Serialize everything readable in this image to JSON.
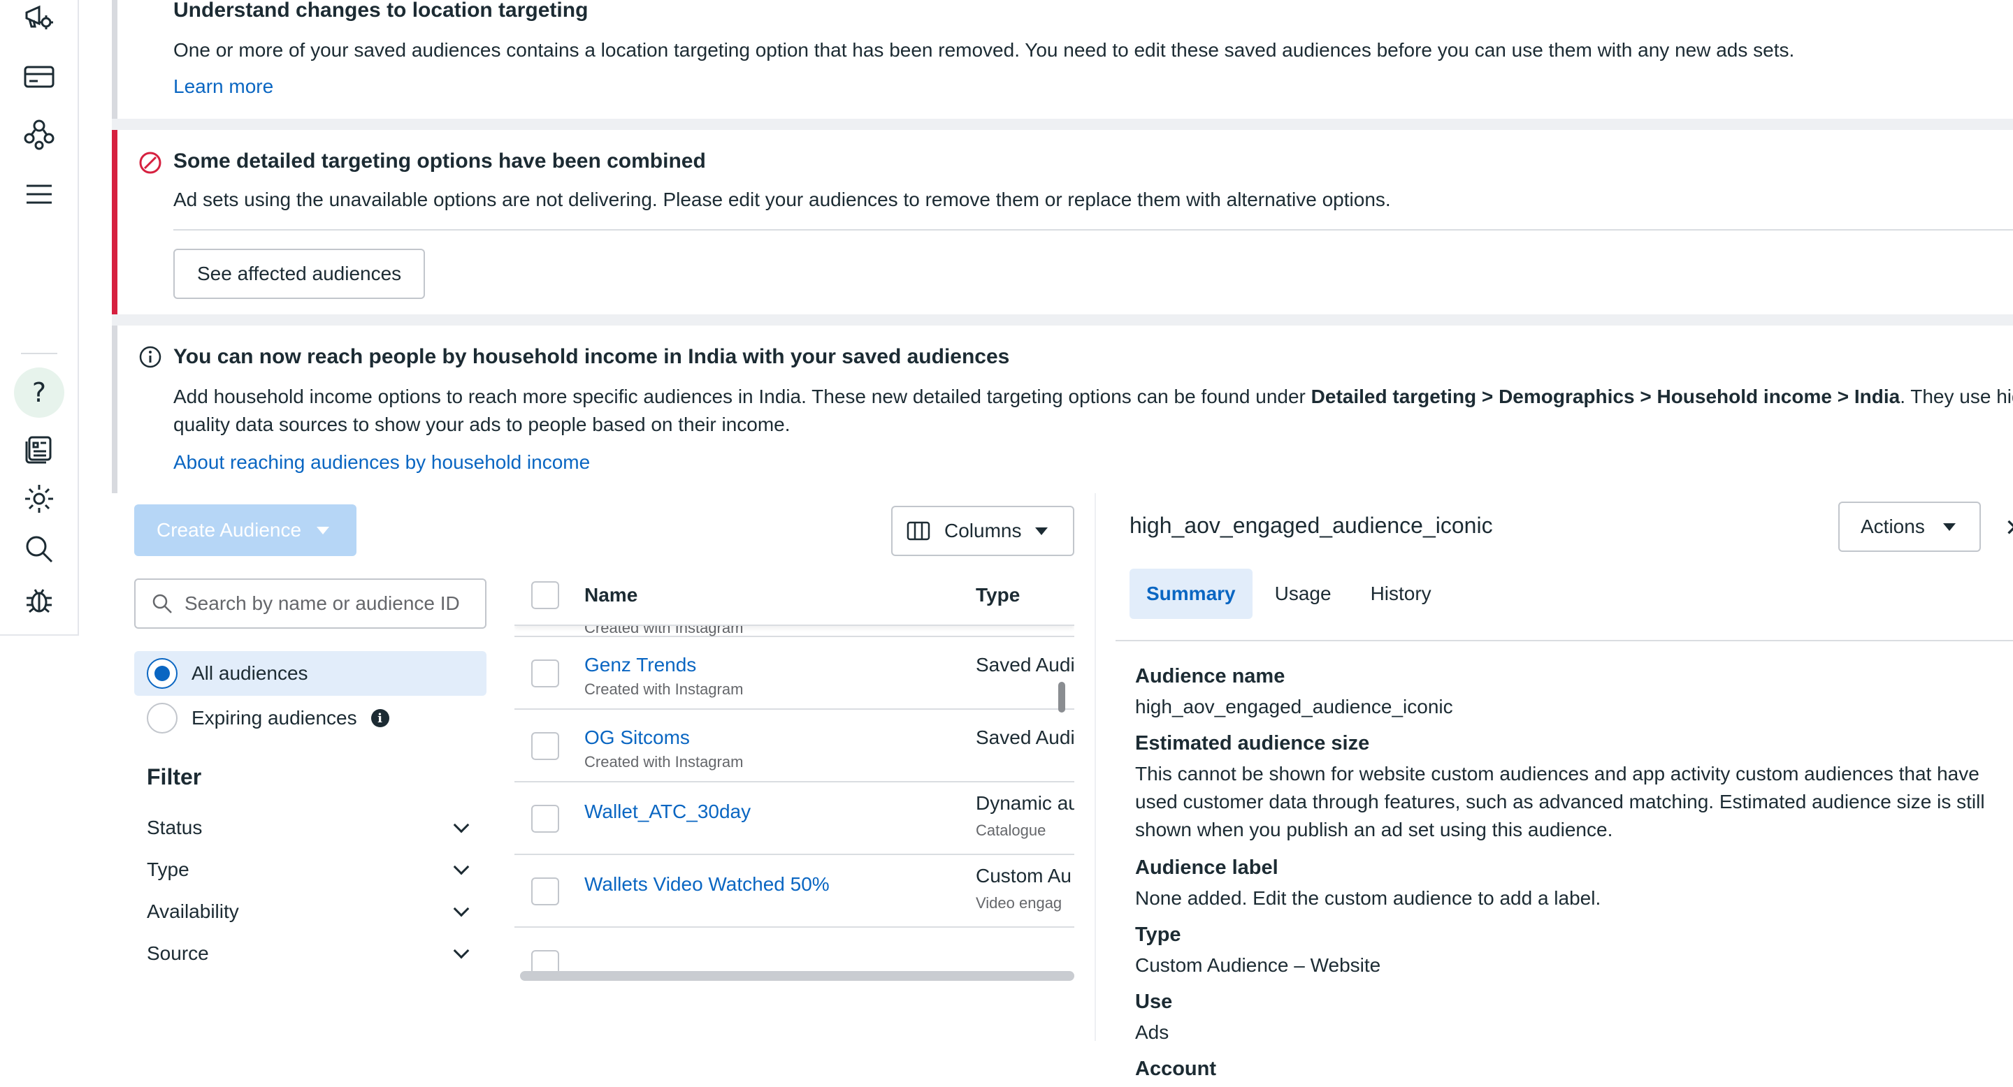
{
  "rail": {
    "icons": [
      "megaphone-gear-icon",
      "billing-card-icon",
      "audiences-icon",
      "menu-icon",
      "help-icon",
      "pages-icon",
      "settings-gear-icon",
      "search-icon",
      "bug-icon"
    ]
  },
  "notices": {
    "location": {
      "title": "Understand changes to location targeting",
      "body": "One or more of your saved audiences contains a location targeting option that has been removed. You need to edit these saved audiences before you can use them with any new ads sets.",
      "link": "Learn more"
    },
    "combined": {
      "title": "Some detailed targeting options have been combined",
      "body": "Ad sets using the unavailable options are not delivering. Please edit your audiences to remove them or replace them with alternative options.",
      "button": "See affected audiences"
    },
    "income": {
      "title": "You can now reach people by household income in India with your saved audiences",
      "body_prefix": "Add household income options to reach more specific audiences in India. These new detailed targeting options can be found under ",
      "body_bold": "Detailed targeting > Demographics > Household income > India",
      "body_suffix": ". They use hig",
      "body_line2": "quality data sources to show your ads to people based on their income.",
      "link": "About reaching audiences by household income"
    }
  },
  "list": {
    "create_label": "Create Audience",
    "columns_label": "Columns",
    "search_placeholder": "Search by name or audience ID",
    "radios": [
      {
        "label": "All audiences",
        "selected": true
      },
      {
        "label": "Expiring audiences",
        "selected": false
      }
    ],
    "filter_title": "Filter",
    "filters": [
      "Status",
      "Type",
      "Availability",
      "Source"
    ],
    "table": {
      "headers": {
        "name": "Name",
        "type": "Type"
      },
      "partial_top_sub": "Created with Instagram",
      "rows": [
        {
          "name": "Genz Trends",
          "sub": "Created with Instagram",
          "type": "Saved Audi",
          "type_sub": ""
        },
        {
          "name": "OG Sitcoms",
          "sub": "Created with Instagram",
          "type": "Saved Audi",
          "type_sub": ""
        },
        {
          "name": "Wallet_ATC_30day",
          "sub": "",
          "type": "Dynamic au",
          "type_sub": "Catalogue"
        },
        {
          "name": "Wallets Video Watched 50%",
          "sub": "",
          "type": "Custom Au",
          "type_sub": "Video engag"
        }
      ]
    }
  },
  "detail": {
    "title": "high_aov_engaged_audience_iconic",
    "actions_label": "Actions",
    "tabs": [
      "Summary",
      "Usage",
      "History"
    ],
    "fields": {
      "name_label": "Audience name",
      "name_value": "high_aov_engaged_audience_iconic",
      "size_label": "Estimated audience size",
      "size_value": "This cannot be shown for website custom audiences and app activity custom audiences that have used customer data through features, such as advanced matching. Estimated audience size is still shown when you publish an ad set using this audience.",
      "label_label": "Audience label",
      "label_value": "None added. Edit the custom audience to add a label.",
      "type_label": "Type",
      "type_value": "Custom Audience – Website",
      "use_label": "Use",
      "use_value": "Ads",
      "account_label": "Account"
    }
  },
  "colors": {
    "link": "#0a66c2",
    "error": "#d6203f",
    "create_button_disabled": "#b6d6f6",
    "active_tab_bg": "#e2edfa"
  }
}
